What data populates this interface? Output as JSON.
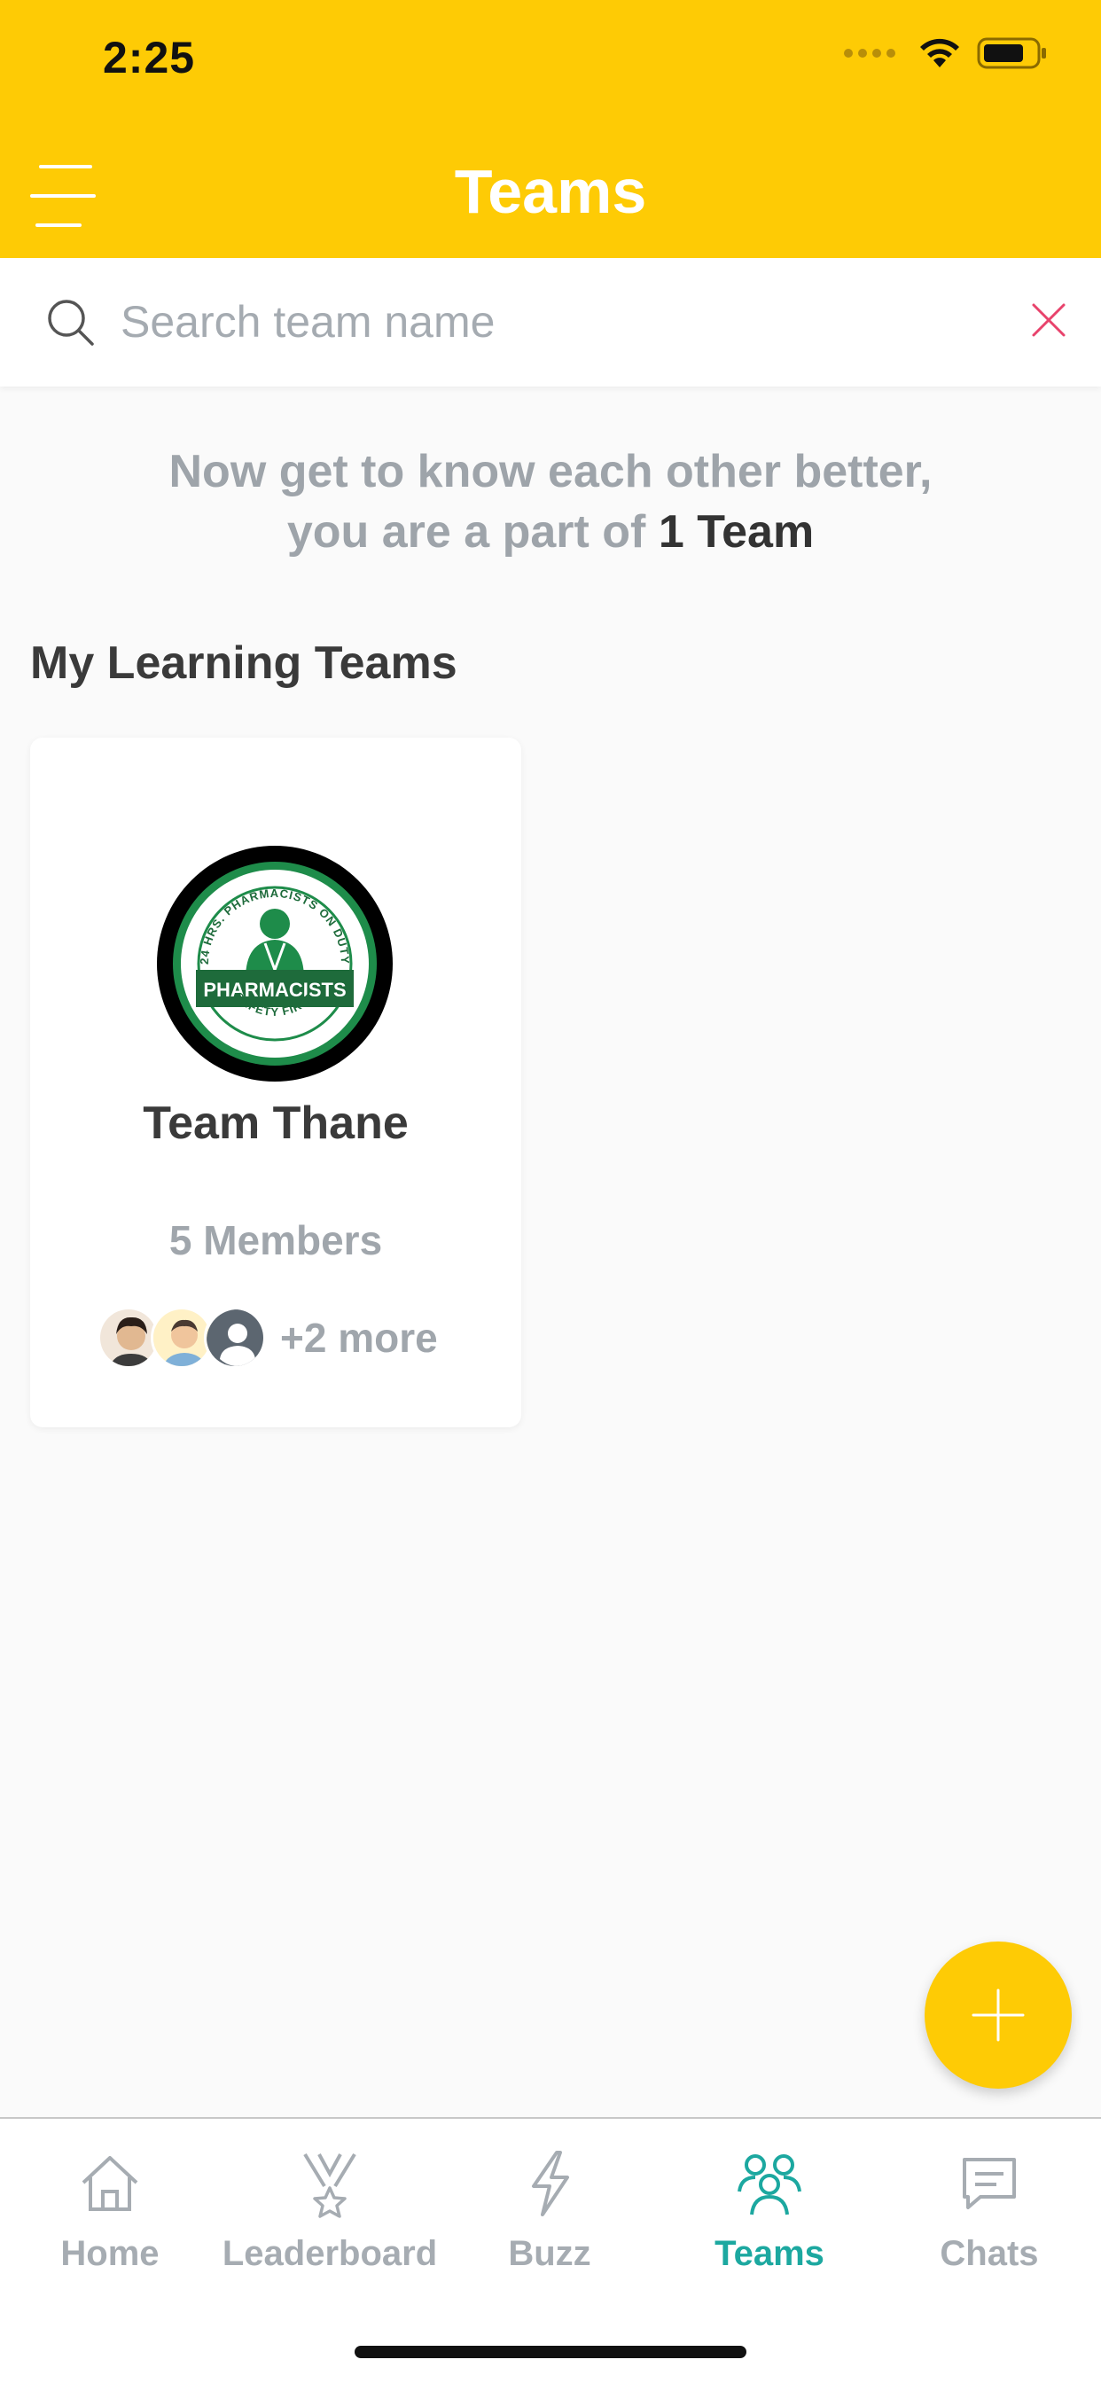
{
  "status_bar": {
    "time": "2:25"
  },
  "header": {
    "title": "Teams",
    "menu_icon": "hamburger-menu-icon"
  },
  "search": {
    "placeholder": "Search team name",
    "value": ""
  },
  "intro": {
    "line1": "Now get to know each other better,",
    "line2_prefix": "you are a part of",
    "line2_strong": "1 Team"
  },
  "section": {
    "title": "My Learning Teams"
  },
  "teams": [
    {
      "name": "Team Thane",
      "members_label": "5 Members",
      "more_label": "+2 more",
      "logo": {
        "top_text": "24 HRS. PHARMACISTS ON DUTY",
        "banner_text": "PHARMACISTS",
        "bottom_text": "SAFETY FIRST"
      }
    }
  ],
  "tabbar": {
    "items": [
      {
        "label": "Home",
        "icon": "home-icon",
        "active": false
      },
      {
        "label": "Leaderboard",
        "icon": "medal-icon",
        "active": false
      },
      {
        "label": "Buzz",
        "icon": "lightning-icon",
        "active": false
      },
      {
        "label": "Teams",
        "icon": "people-icon",
        "active": true
      },
      {
        "label": "Chats",
        "icon": "chat-bubble-icon",
        "active": false
      }
    ]
  },
  "colors": {
    "brand_yellow": "#fecb05",
    "active_teal": "#1ca8a0",
    "clear_red": "#e8436c",
    "muted_gray": "#a6acb2"
  }
}
